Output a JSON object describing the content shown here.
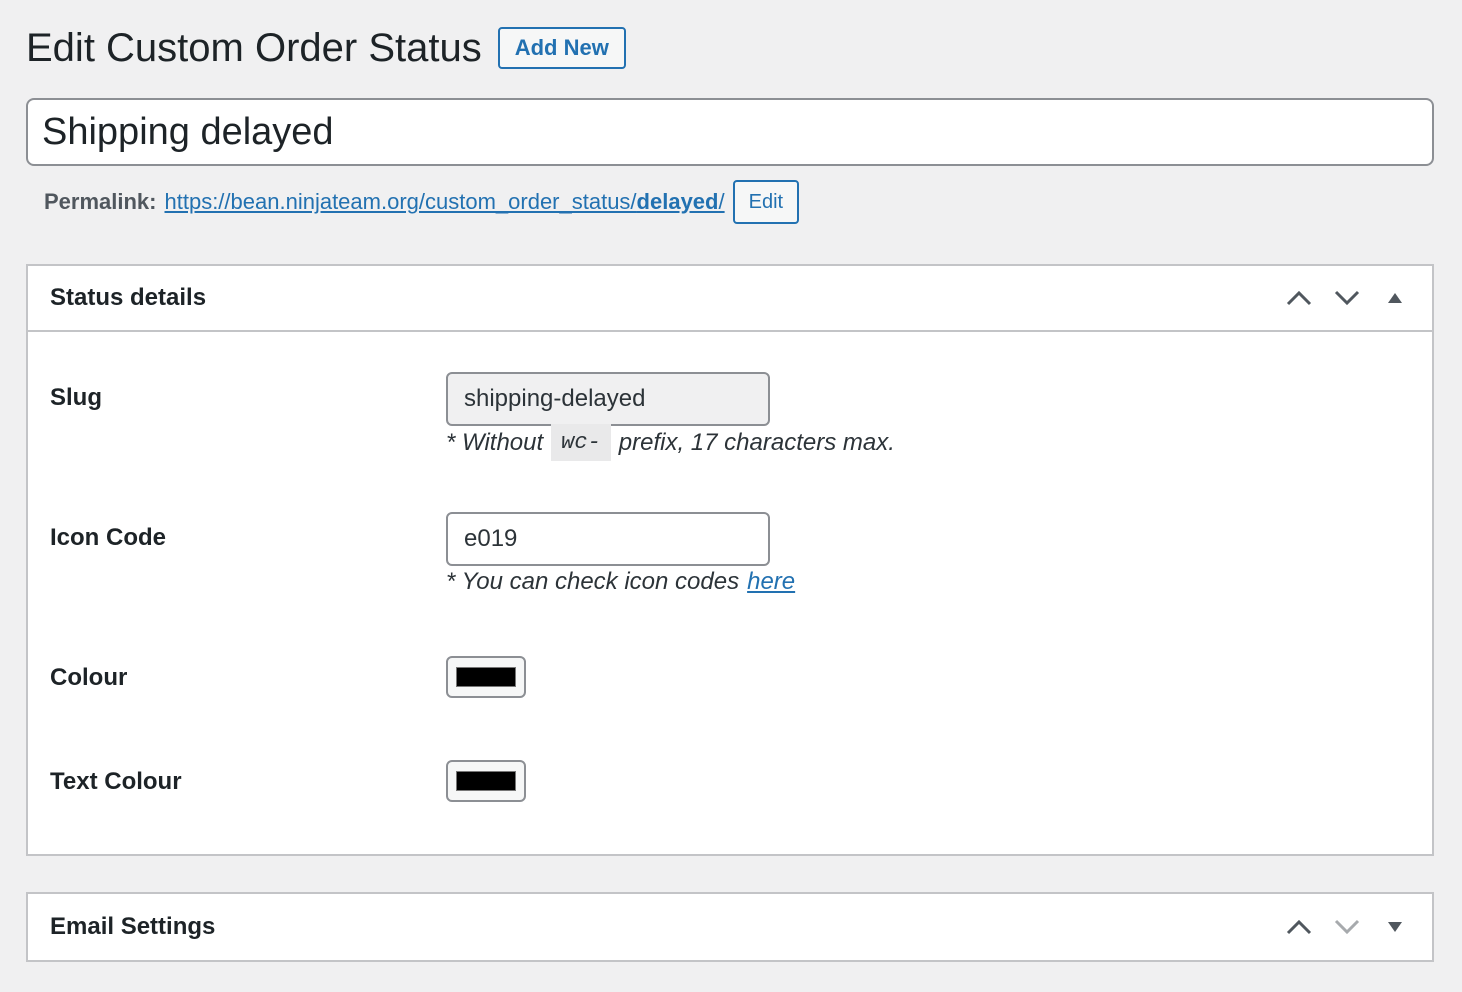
{
  "header": {
    "title": "Edit Custom Order Status",
    "add_new_label": "Add New"
  },
  "post_title": {
    "value": "Shipping delayed"
  },
  "permalink": {
    "label": "Permalink:",
    "url_base": "https://bean.ninjateam.org/custom_order_status/",
    "url_slug": "delayed",
    "url_trailing": "/",
    "edit_label": "Edit"
  },
  "status_details": {
    "title": "Status details",
    "controls": [
      "chevron-up-icon",
      "chevron-down-icon",
      "toggle-triangle-up-icon"
    ],
    "slug": {
      "label": "Slug",
      "value": "shipping-delayed",
      "help_prefix": "* Without",
      "help_code": "wc-",
      "help_suffix": "prefix, 17 characters max."
    },
    "icon_code": {
      "label": "Icon Code",
      "value": "e019",
      "help_text": "* You can check icon codes",
      "help_link": "here"
    },
    "colour": {
      "label": "Colour",
      "value": "#000000"
    },
    "text_colour": {
      "label": "Text Colour",
      "value": "#000000"
    }
  },
  "email_settings": {
    "title": "Email Settings",
    "controls": [
      "chevron-up-icon",
      "chevron-down-icon",
      "toggle-triangle-down-icon"
    ]
  },
  "colors": {
    "accent": "#2271b1",
    "background": "#f0f0f1",
    "text": "#1d2327"
  }
}
